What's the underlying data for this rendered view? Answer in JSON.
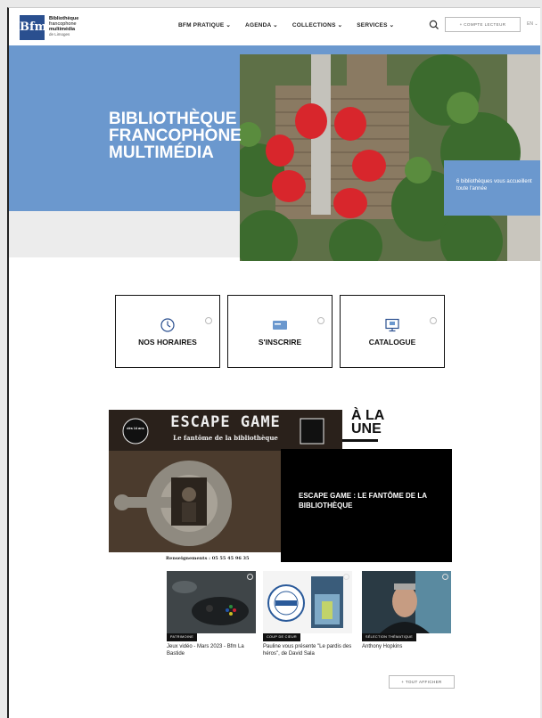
{
  "header": {
    "logo_mark": "Bfm",
    "logo_lines": [
      "Bibliothèque",
      "francophone",
      "multimédia"
    ],
    "logo_sub": "de Limoges",
    "nav": [
      "BFM PRATIQUE ⌄",
      "AGENDA ⌄",
      "COLLECTIONS ⌄",
      "SERVICES ⌄"
    ],
    "account_label": "+  COMPTE LECTEUR",
    "lang_label": "EN ⌄"
  },
  "hero": {
    "title": "BIBLIOTHÈQUE FRANCOPHONE MULTIMÉDIA",
    "caption": "6 bibliothèques vous accueillent toute l'année"
  },
  "quick_links": [
    {
      "label": "NOS HORAIRES",
      "icon": "clock-icon"
    },
    {
      "label": "S'INSCRIRE",
      "icon": "card-icon"
    },
    {
      "label": "CATALOGUE",
      "icon": "monitor-icon"
    }
  ],
  "feature": {
    "section_title": "À LA UNE",
    "poster_title": "ESCAPE GAME",
    "poster_subtitle": "Le fantôme de la bibliothèque",
    "poster_badge": "dès 14 ans",
    "poster_footer": "Renseignements : 05 55 45 96 35",
    "headline": "ESCAPE GAME : LE FANTÔME DE LA BIBLIOTHÈQUE"
  },
  "cards": [
    {
      "tag": "PATRIMOINE",
      "title": "Jeux vidéo - Mars 2023 - Bfm La Bastide"
    },
    {
      "tag": "COUP DE CŒUR",
      "title": "Pauline vous présente \"Le pardis des héros\", de David Sala"
    },
    {
      "tag": "SÉLECTION THÉMATIQUE",
      "title": "Anthony Hopkins"
    }
  ],
  "more_label": "+  TOUT AFFICHER",
  "colors": {
    "accent_blue": "#6b98ce",
    "logo_blue": "#2a4f8f",
    "black": "#000000"
  }
}
